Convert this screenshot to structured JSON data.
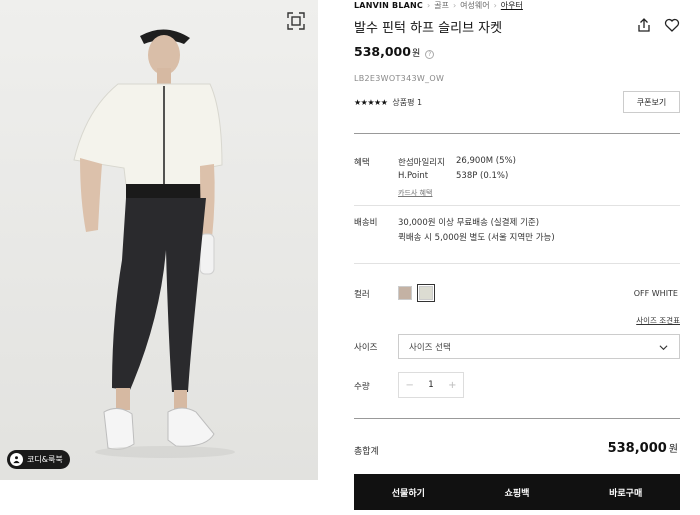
{
  "breadcrumb": {
    "brand": "LANVIN BLANC",
    "items": [
      "골프",
      "여성웨어",
      "아우터"
    ]
  },
  "product": {
    "title": "발수 핀턱 하프 슬리브 자켓",
    "price": "538,000",
    "price_unit": "원",
    "code": "LB2E3WOT343W_OW",
    "stars": "★★★★★",
    "rating_text": "상품평 1",
    "coupon_label": "쿠폰보기"
  },
  "benefit": {
    "label": "혜택",
    "rows": [
      {
        "name": "한섬마일리지",
        "value": "26,900M (5%)"
      },
      {
        "name": "H.Point",
        "value": "538P (0.1%)"
      }
    ],
    "card_link": "카드사 혜택"
  },
  "shipping": {
    "label": "배송비",
    "line1": "30,000원 이상 무료배송 (실결제 기준)",
    "line2": "퀵배송 시 5,000원 별도 (서울 지역만 가능)"
  },
  "color": {
    "label": "컬러",
    "swatches": [
      "#c4b2a4",
      "#dcdcd2"
    ],
    "selected_name": "OFF WHITE"
  },
  "size": {
    "label": "사이즈",
    "guide": "사이즈 조견표",
    "placeholder": "사이즈 선택"
  },
  "quantity": {
    "label": "수량",
    "value": "1"
  },
  "total": {
    "label": "총합계",
    "value": "538,000",
    "unit": "원"
  },
  "actions": {
    "gift": "선물하기",
    "cart": "쇼핑백",
    "buy": "바로구매"
  },
  "image": {
    "cody_label": "코디&룩북"
  }
}
